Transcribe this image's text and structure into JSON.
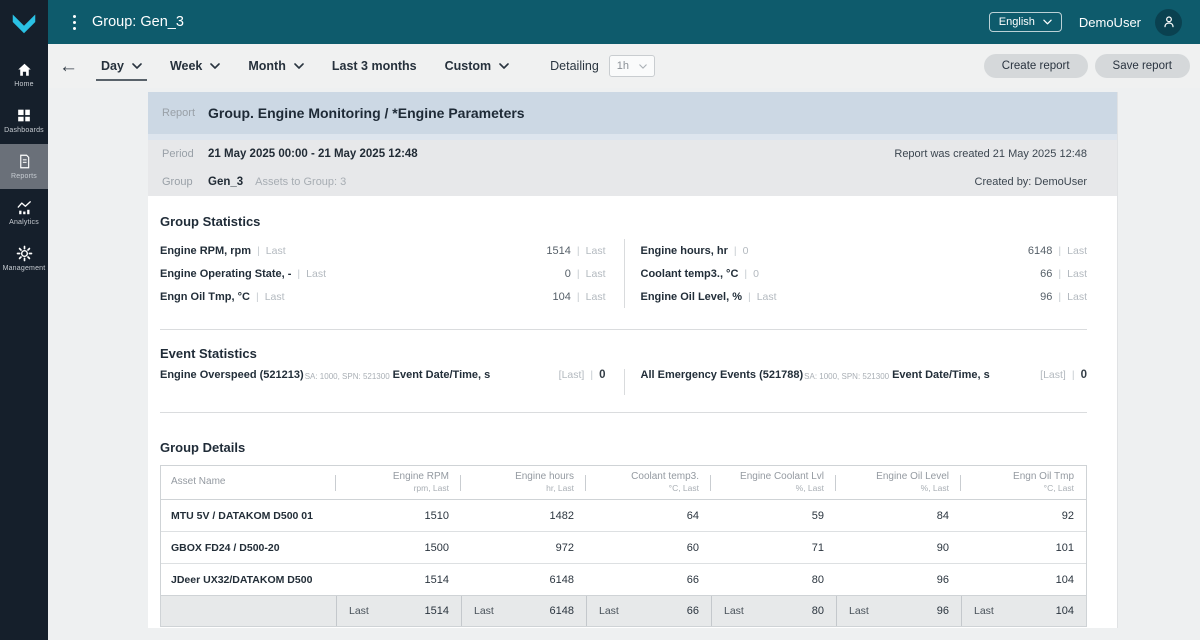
{
  "colors": {
    "topbar": "#0e5b6c",
    "sidebar": "#151f2b",
    "accent": "#2ac1e4",
    "report_row": "#ccd8e4",
    "meta_row": "#e7e8ea",
    "footer_row": "#e7e9ea"
  },
  "topbar": {
    "title": "Group: Gen_3",
    "language": "English",
    "user": "DemoUser"
  },
  "sidebar": {
    "items": [
      {
        "label": "Home",
        "icon": "home",
        "active": false
      },
      {
        "label": "Dashboards",
        "icon": "dashboards",
        "active": false
      },
      {
        "label": "Reports",
        "icon": "reports",
        "active": true
      },
      {
        "label": "Analytics",
        "icon": "analytics",
        "active": false
      },
      {
        "label": "Management",
        "icon": "management",
        "active": false
      }
    ]
  },
  "toolbar": {
    "tabs": [
      {
        "label": "Day",
        "dropdown": true,
        "active": true
      },
      {
        "label": "Week",
        "dropdown": true,
        "active": false
      },
      {
        "label": "Month",
        "dropdown": true,
        "active": false
      },
      {
        "label": "Last 3 months",
        "dropdown": false,
        "active": false
      },
      {
        "label": "Custom",
        "dropdown": true,
        "active": false
      }
    ],
    "detailing_label": "Detailing",
    "detailing_value": "1h",
    "create_report": "Create report",
    "save_report": "Save report"
  },
  "report_header": {
    "report_label": "Report",
    "report_title": "Group. Engine Monitoring / *Engine Parameters",
    "period_label": "Period",
    "period_value": "21 May 2025 00:00 - 21 May 2025 12:48",
    "created_at": "Report was created 21 May 2025 12:48",
    "group_label": "Group",
    "group_value": "Gen_3",
    "assets_info": "Assets to Group: 3",
    "created_by": "Created by: DemoUser"
  },
  "group_statistics": {
    "title": "Group Statistics",
    "left": [
      {
        "label": "Engine RPM, rpm",
        "sub": "Last",
        "value": "1514",
        "agg": "Last"
      },
      {
        "label": "Engine Operating State, -",
        "sub": "Last",
        "value": "0",
        "agg": "Last"
      },
      {
        "label": "Engn Oil Tmp, °C",
        "sub": "Last",
        "value": "104",
        "agg": "Last"
      }
    ],
    "right": [
      {
        "label": "Engine hours, hr",
        "sub": "0",
        "value": "6148",
        "agg": "Last"
      },
      {
        "label": "Coolant temp3., °C",
        "sub": "0",
        "value": "66",
        "agg": "Last"
      },
      {
        "label": "Engine Oil Level, %",
        "sub": "Last",
        "value": "96",
        "agg": "Last"
      }
    ]
  },
  "event_statistics": {
    "title": "Event Statistics",
    "events": [
      {
        "name": "Engine Overspeed (521213)",
        "meta": "SA: 1000, SPN: 521300",
        "suffix": "Event Date/Time, s",
        "agg": "[Last]",
        "value": "0"
      },
      {
        "name": "All Emergency Events (521788)",
        "meta": "SA: 1000, SPN: 521300",
        "suffix": "Event Date/Time, s",
        "agg": "[Last]",
        "value": "0"
      }
    ]
  },
  "group_details": {
    "title": "Group Details",
    "columns": [
      {
        "name": "Asset Name",
        "sub": ""
      },
      {
        "name": "Engine RPM",
        "sub": "rpm, Last"
      },
      {
        "name": "Engine hours",
        "sub": "hr, Last"
      },
      {
        "name": "Coolant temp3.",
        "sub": "°C, Last"
      },
      {
        "name": "Engine Coolant Lvl",
        "sub": "%, Last"
      },
      {
        "name": "Engine Oil Level",
        "sub": "%, Last"
      },
      {
        "name": "Engn Oil Tmp",
        "sub": "°C, Last"
      }
    ],
    "rows": [
      {
        "asset": "MTU 5V / DATAKOM D500 01",
        "values": [
          "1510",
          "1482",
          "64",
          "59",
          "84",
          "92"
        ]
      },
      {
        "asset": "GBOX FD24 / D500-20",
        "values": [
          "1500",
          "972",
          "60",
          "71",
          "90",
          "101"
        ]
      },
      {
        "asset": "JDeer UX32/DATAKOM D500",
        "values": [
          "1514",
          "6148",
          "66",
          "80",
          "96",
          "104"
        ]
      }
    ],
    "footer": {
      "agg": "Last",
      "values": [
        "1514",
        "6148",
        "66",
        "80",
        "96",
        "104"
      ]
    }
  }
}
